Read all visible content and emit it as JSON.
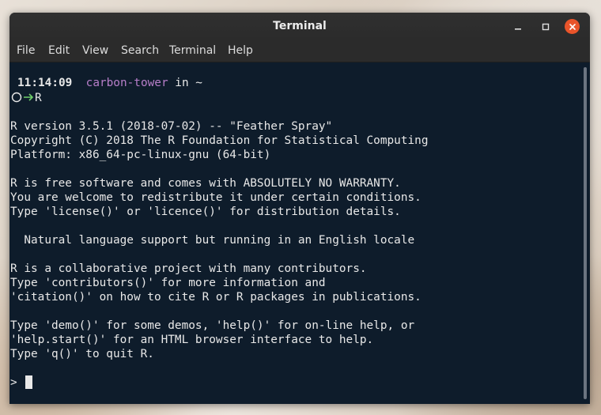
{
  "window": {
    "title": "Terminal"
  },
  "menu": [
    "File",
    "Edit",
    "Search",
    "View",
    "Terminal",
    "Help"
  ],
  "menu_items": {
    "file": "File",
    "edit": "Edit",
    "view": "View",
    "search": "Search",
    "terminal": "Terminal",
    "help": "Help"
  },
  "prompt": {
    "time": "11:14:09",
    "host": "carbon-tower",
    "in": "in",
    "dir": "~",
    "command": "R"
  },
  "output": {
    "l1": "R version 3.5.1 (2018-07-02) -- \"Feather Spray\"",
    "l2": "Copyright (C) 2018 The R Foundation for Statistical Computing",
    "l3": "Platform: x86_64-pc-linux-gnu (64-bit)",
    "l4": "R is free software and comes with ABSOLUTELY NO WARRANTY.",
    "l5": "You are welcome to redistribute it under certain conditions.",
    "l6": "Type 'license()' or 'licence()' for distribution details.",
    "l7": "  Natural language support but running in an English locale",
    "l8": "R is a collaborative project with many contributors.",
    "l9": "Type 'contributors()' for more information and",
    "l10": "'citation()' on how to cite R or R packages in publications.",
    "l11": "Type 'demo()' for some demos, 'help()' for on-line help, or",
    "l12": "'help.start()' for an HTML browser interface to help.",
    "l13": "Type 'q()' to quit R."
  },
  "r_prompt": ">",
  "colors": {
    "terminal_bg": "#0e1c2b",
    "host": "#b77ec9",
    "arrow": "#6fcf6a",
    "close_button": "#e9542a"
  }
}
